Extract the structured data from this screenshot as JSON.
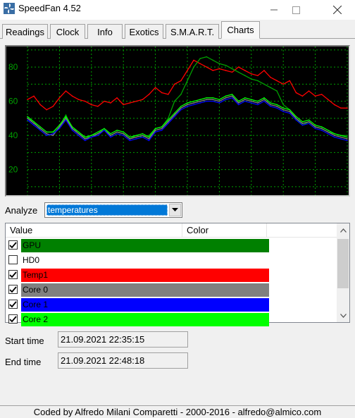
{
  "window": {
    "title": "SpeedFan 4.52"
  },
  "tabs": [
    {
      "label": "Readings"
    },
    {
      "label": "Clock"
    },
    {
      "label": "Info"
    },
    {
      "label": "Exotics"
    },
    {
      "label": "S.M.A.R.T."
    },
    {
      "label": "Charts",
      "active": true
    }
  ],
  "chart_data": {
    "type": "line",
    "background": "#000000",
    "grid_color": "#00a000",
    "grid": true,
    "y_ticks": [
      "80",
      "60",
      "40",
      "20"
    ],
    "ylim": [
      5,
      92
    ],
    "x": [
      0,
      2,
      4,
      6,
      8,
      10,
      12,
      14,
      16,
      18,
      20,
      22,
      24,
      26,
      28,
      30,
      32,
      34,
      36,
      38,
      40,
      42,
      44,
      46,
      48,
      50,
      52,
      54,
      56,
      58,
      60,
      62,
      64,
      66,
      68,
      70,
      72,
      74,
      76,
      78,
      80,
      82,
      84,
      86,
      88,
      90,
      92,
      94,
      96,
      98,
      100
    ],
    "series": [
      {
        "name": "Temp1",
        "color": "#ff0000",
        "values": [
          61,
          63,
          58,
          55,
          57,
          62,
          66,
          63,
          61,
          60,
          58,
          57,
          60,
          59,
          62,
          58,
          59,
          60,
          61,
          64,
          68,
          65,
          64,
          70,
          72,
          78,
          84,
          82,
          80,
          78,
          79,
          78,
          77,
          80,
          78,
          76,
          75,
          78,
          74,
          72,
          70,
          72,
          65,
          63,
          66,
          63,
          64,
          61,
          58,
          56,
          56
        ]
      },
      {
        "name": "GPU",
        "color": "#00a000",
        "values": [
          50,
          48,
          43,
          40,
          41,
          45,
          52,
          44,
          42,
          38,
          40,
          41,
          44,
          40,
          42,
          41,
          38,
          40,
          39,
          40,
          44,
          45,
          50,
          60,
          64,
          72,
          80,
          85,
          86,
          84,
          82,
          81,
          79,
          77,
          75,
          73,
          72,
          70,
          68,
          66,
          58,
          55,
          50,
          46,
          48,
          45,
          44,
          42,
          41,
          40,
          40
        ]
      },
      {
        "name": "Core 0",
        "color": "#808080",
        "values": [
          50,
          47,
          44,
          41,
          40,
          45,
          50,
          44,
          41,
          38,
          39,
          41,
          43,
          40,
          42,
          41,
          38,
          39,
          40,
          38,
          43,
          44,
          48,
          52,
          56,
          58,
          59,
          60,
          61,
          61,
          60,
          62,
          63,
          59,
          61,
          60,
          59,
          61,
          58,
          57,
          55,
          54,
          50,
          47,
          48,
          45,
          44,
          42,
          40,
          39,
          38
        ]
      },
      {
        "name": "Core 1",
        "color": "#0000ff",
        "values": [
          49,
          46,
          43,
          40,
          41,
          44,
          49,
          43,
          40,
          37,
          39,
          40,
          43,
          39,
          41,
          40,
          37,
          38,
          39,
          37,
          42,
          43,
          47,
          51,
          55,
          57,
          58,
          59,
          60,
          60,
          59,
          61,
          62,
          58,
          60,
          59,
          58,
          60,
          57,
          56,
          54,
          53,
          49,
          46,
          47,
          44,
          43,
          41,
          39,
          38,
          37
        ]
      },
      {
        "name": "Core 2",
        "color": "#00ff00",
        "values": [
          51,
          48,
          45,
          42,
          42,
          46,
          51,
          45,
          42,
          39,
          40,
          42,
          44,
          41,
          43,
          42,
          39,
          40,
          41,
          39,
          44,
          45,
          49,
          53,
          57,
          59,
          60,
          61,
          62,
          62,
          61,
          63,
          64,
          60,
          62,
          61,
          60,
          62,
          59,
          58,
          56,
          55,
          51,
          48,
          49,
          46,
          45,
          43,
          41,
          40,
          39
        ]
      }
    ]
  },
  "analyze": {
    "label": "Analyze",
    "value": "temperatures"
  },
  "listview": {
    "col_value": "Value",
    "col_color": "Color",
    "rows": [
      {
        "name": "GPU",
        "checked": true,
        "color": "#008000"
      },
      {
        "name": "HD0",
        "checked": false,
        "color": "#ffffff"
      },
      {
        "name": "Temp1",
        "checked": true,
        "color": "#ff0000"
      },
      {
        "name": "Core 0",
        "checked": true,
        "color": "#808080"
      },
      {
        "name": "Core 1",
        "checked": true,
        "color": "#0000ff"
      },
      {
        "name": "Core 2",
        "checked": true,
        "color": "#00ff00"
      }
    ]
  },
  "start_time": {
    "label": "Start time",
    "value": "21.09.2021 22:35:15"
  },
  "end_time": {
    "label": "End time",
    "value": "21.09.2021 22:48:18"
  },
  "footer": {
    "text": "Coded by Alfredo Milani Comparetti - 2000-2016 - alfredo@almico.com"
  }
}
